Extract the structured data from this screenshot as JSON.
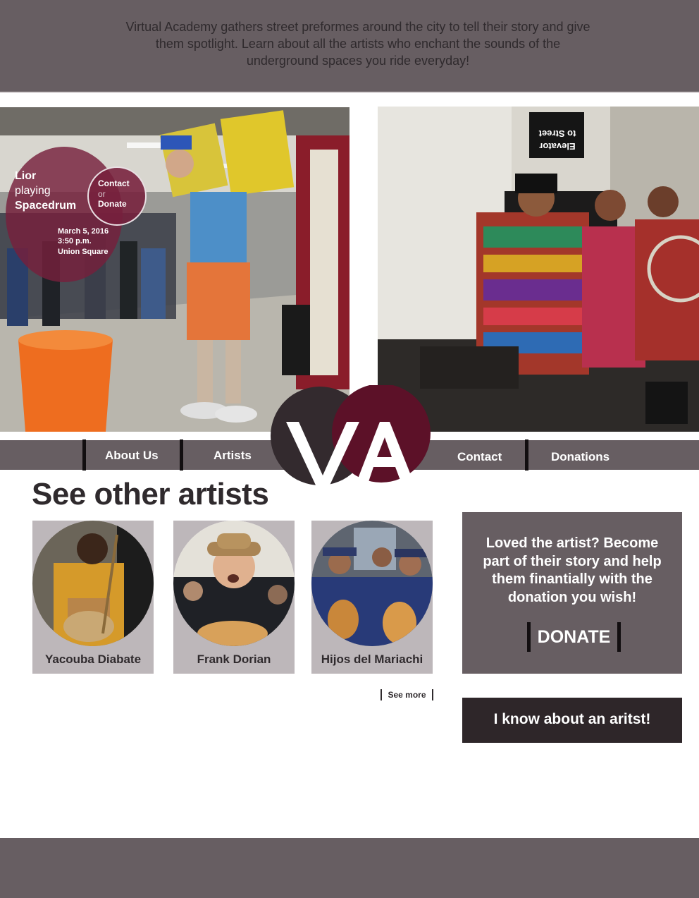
{
  "intro": {
    "text": "Virtual Academy gathers street preformes around the city to tell their story and give them spotlight. Learn about all the artists who enchant the sounds of the underground spaces you ride everyday!"
  },
  "featured": {
    "artist_name": "Lior",
    "verb": "playing",
    "instrument": "Spacedrum",
    "contact_label": "Contact",
    "or_label": "or",
    "donate_label": "Donate",
    "date": "March 5, 2016",
    "time": "3:50 p.m.",
    "location": "Union Square"
  },
  "subway_sign": {
    "line1": "Elevator",
    "line2": "to Street"
  },
  "nav": {
    "about": "About Us",
    "artists": "Artists",
    "contact": "Contact",
    "donations": "Donations"
  },
  "logo": {
    "text": "VA",
    "colors": [
      "#332a2e",
      "#5c1128"
    ]
  },
  "section_title": "See other artists",
  "artists": [
    {
      "name": "Yacouba Diabate"
    },
    {
      "name": "Frank Dorian"
    },
    {
      "name": "Hijos del Mariachi"
    }
  ],
  "see_more_label": "See more",
  "donate_panel": {
    "pitch": "Loved the artist? Become part of their story and help them finantially with the donation you wish!",
    "button_label": "DONATE"
  },
  "report_button_label": "I know about an aritst!",
  "colors": {
    "panel_gray": "#675e62",
    "dark": "#2e2629",
    "maroon": "#76203c",
    "card_gray": "#bdb7ba"
  }
}
